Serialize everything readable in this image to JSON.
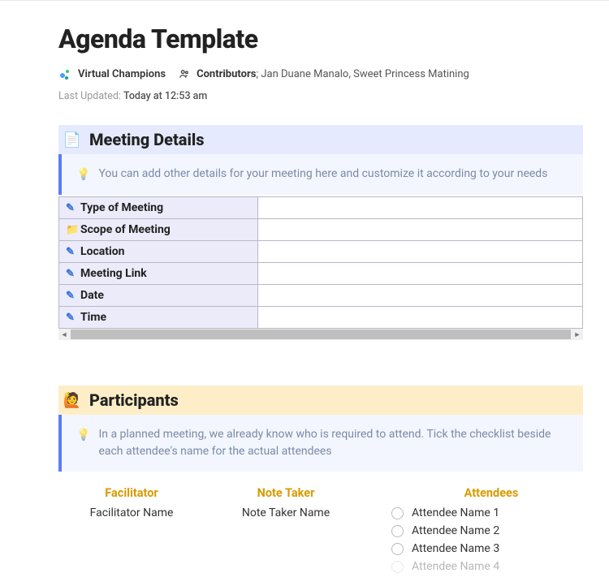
{
  "title": "Agenda Template",
  "org": "Virtual Champions",
  "contributors_label": "Contributors",
  "contributors_names": "; Jan Duane Manalo, Sweet Princess Matining",
  "updated_label": "Last Updated: ",
  "updated_value": "Today at 12:53 am",
  "sections": {
    "meeting_details": {
      "heading": "Meeting Details",
      "tip": "You can add other details for your meeting here and customize it according to your needs",
      "rows": [
        {
          "icon": "pencil",
          "label": "Type of Meeting",
          "value": ""
        },
        {
          "icon": "folder",
          "label": "Scope of Meeting",
          "value": ""
        },
        {
          "icon": "pencil",
          "label": "Location",
          "value": ""
        },
        {
          "icon": "pencil",
          "label": "Meeting Link",
          "value": ""
        },
        {
          "icon": "pencil",
          "label": "Date",
          "value": ""
        },
        {
          "icon": "pencil",
          "label": "Time",
          "value": ""
        }
      ]
    },
    "participants": {
      "heading": "Participants",
      "tip": "In a planned meeting, we already know who is required to attend. Tick the checklist beside each attendee's name for the actual attendees",
      "facilitator_head": "Facilitator",
      "facilitator_value": "Facilitator Name",
      "notetaker_head": "Note Taker",
      "notetaker_value": "Note Taker Name",
      "attendees_head": "Attendees",
      "attendees": [
        "Attendee Name 1",
        "Attendee Name 2",
        "Attendee Name 3",
        "Attendee Name 4"
      ]
    }
  }
}
